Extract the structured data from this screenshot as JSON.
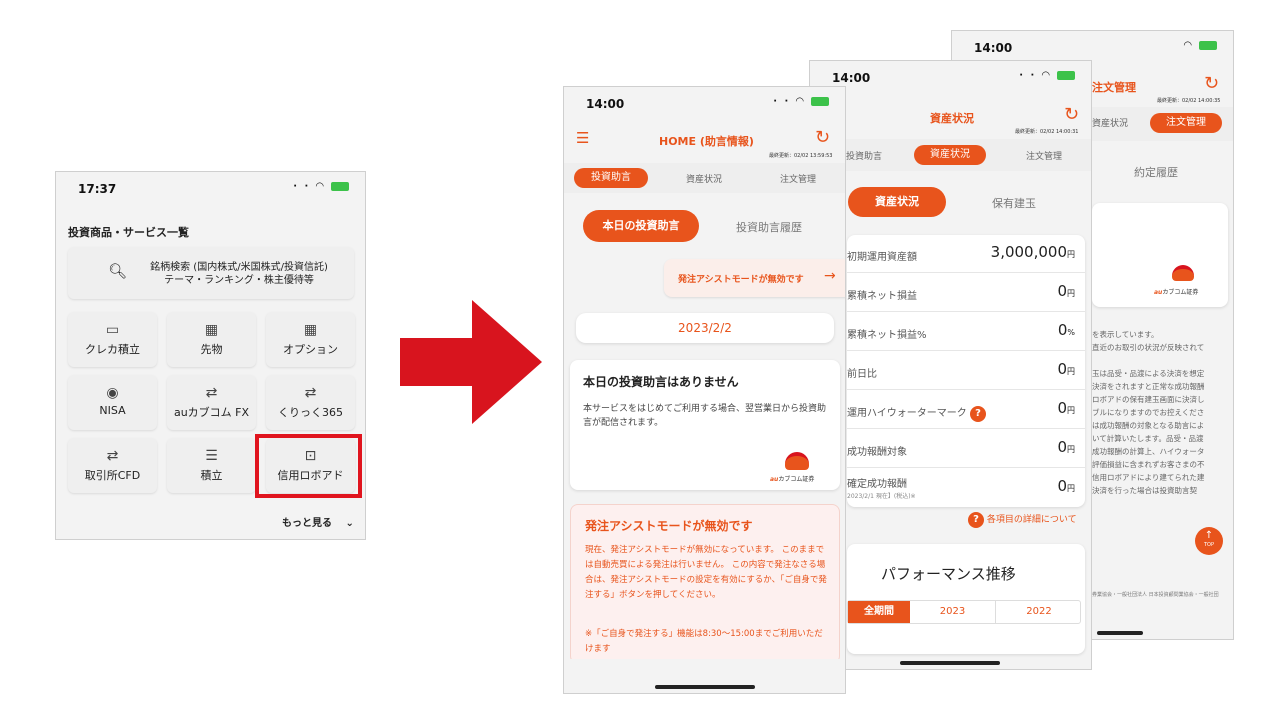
{
  "phone1": {
    "time": "17:37",
    "title": "投資商品・サービス一覧",
    "search_line1": "銘柄検索 (国内株式/米国株式/投資信託)",
    "search_line2": "テーマ・ランキング・株主優待等",
    "tiles": [
      {
        "label": "クレカ積立",
        "icon": "credit-card-icon"
      },
      {
        "label": "先物",
        "icon": "calendar-icon"
      },
      {
        "label": "オプション",
        "icon": "calendar-check-icon"
      },
      {
        "label": "NISA",
        "icon": "piggy-bank-icon"
      },
      {
        "label": "auカブコム FX",
        "icon": "exchange-icon"
      },
      {
        "label": "くりっく365",
        "icon": "exchange-icon"
      },
      {
        "label": "取引所CFD",
        "icon": "exchange-icon"
      },
      {
        "label": "積立",
        "icon": "coins-icon"
      },
      {
        "label": "信用ロボアド",
        "icon": "robot-icon"
      }
    ],
    "more": "もっと見る",
    "highlight_color": "#e0141e"
  },
  "phone2": {
    "time": "14:00",
    "header_title": "HOME (助言情報)",
    "last_update": "最終更新：02/02 13:59:53",
    "tabs": [
      "投資助言",
      "資産状況",
      "注文管理"
    ],
    "sub_tabs": [
      "本日の投資助言",
      "投資助言履歴"
    ],
    "assist_notice": "発注アシストモードが無効です",
    "date": "2023/2/2",
    "no_advice_title": "本日の投資助言はありません",
    "no_advice_body": "本サービスをはじめてご利用する場合、翌営業日から投資助言が配信されます。",
    "logo_text": "カブコム証券",
    "logo_prefix": "au",
    "warning_title": "発注アシストモードが無効です",
    "warning_body": "現在、発注アシストモードが無効になっています。 このままでは自動売買による発注は行いません。 この内容で発注なさる場合は、発注アシストモードの設定を有効にするか、「ご自身で発注する」ボタンを押してください。",
    "warning_note": "※「ご自身で発注する」機能は8:30〜15:00までご利用いただけます"
  },
  "phone3": {
    "time": "14:00",
    "header_title": "資産状況",
    "last_update": "最終更新：02/02 14:00:31",
    "tabs": [
      "投資助言",
      "資産状況",
      "注文管理"
    ],
    "sub_tabs": [
      "資産状況",
      "保有建玉"
    ],
    "rows": [
      {
        "label": "初期運用資産額",
        "value": "3,000,000",
        "unit": "円"
      },
      {
        "label": "累積ネット損益",
        "value": "0",
        "unit": "円"
      },
      {
        "label": "累積ネット損益%",
        "value": "0",
        "unit": "%"
      },
      {
        "label": "前日比",
        "value": "0",
        "unit": "円"
      },
      {
        "label": "運用ハイウォーターマーク",
        "value": "0",
        "unit": "円"
      },
      {
        "label": "成功報酬対象",
        "value": "0",
        "unit": "円"
      },
      {
        "label": "確定成功報酬",
        "sub": "2023/2/1 現在】(税込)※",
        "value": "0",
        "unit": "円"
      }
    ],
    "help_link": "各項目の詳細について",
    "performance_title": "パフォーマンス推移",
    "periods": [
      "全期間",
      "2023",
      "2022"
    ]
  },
  "phone4": {
    "time": "14:00",
    "header_title": "注文管理",
    "last_update": "最終更新：02/02 14:00:35",
    "tabs": [
      "資産状況",
      "注文管理"
    ],
    "section": "約定履歴",
    "logo_text": "カブコム証券",
    "logo_prefix": "au",
    "text_lines": [
      "を表示しています。",
      "直近のお取引の状況が反映されて",
      "玉は品受・品渡による決済を想定",
      "決済をされますと正常な成功報酬",
      "ロボアドの保有建玉画面に決済し",
      "ブルになりますのでお控えくださ",
      "は成功報酬の対象となる助言によ",
      "いて計算いたします。品受・品渡",
      "成功報酬の計算上、ハイウォータ",
      "評価損益に含まれずお客さまの不",
      "信用ロボアドにより建てられた建",
      "決済を行った場合は投資助言契"
    ],
    "top_button": "TOP",
    "footer": "券業協会・一般社団法人 日本投資顧問業協会・一般社団"
  }
}
